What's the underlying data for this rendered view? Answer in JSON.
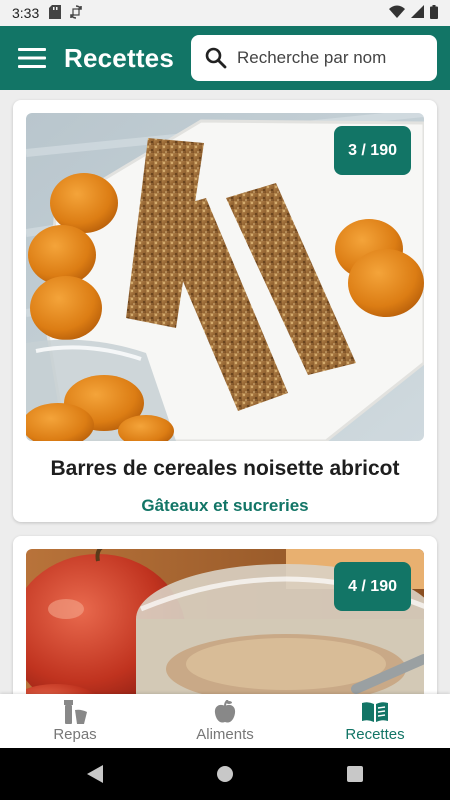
{
  "status_bar": {
    "time": "3:33",
    "left_icons": [
      "sd-card-icon",
      "sync-icon"
    ],
    "right_icons": [
      "wifi-icon",
      "signal-icon",
      "battery-icon"
    ]
  },
  "app_bar": {
    "title": "Recettes",
    "search_placeholder": "Recherche par nom",
    "background_color": "#127566"
  },
  "recipes": [
    {
      "counter": "3 / 190",
      "title": "Barres de cereales noisette abricot",
      "category": "Gâteaux et sucreries",
      "image": "photo of oat cereal bars with dried apricots on a white plate"
    },
    {
      "counter": "4 / 190",
      "title": "",
      "category": "",
      "image": "photo of an apple next to a glass jar"
    }
  ],
  "bottom_nav": {
    "items": [
      {
        "label": "Repas",
        "icon": "meal-icon",
        "active": false
      },
      {
        "label": "Aliments",
        "icon": "apple-icon",
        "active": false
      },
      {
        "label": "Recettes",
        "icon": "book-icon",
        "active": true
      }
    ],
    "active_color": "#127566"
  },
  "system_nav": {
    "buttons": [
      "back-icon",
      "home-icon",
      "recents-icon"
    ]
  }
}
